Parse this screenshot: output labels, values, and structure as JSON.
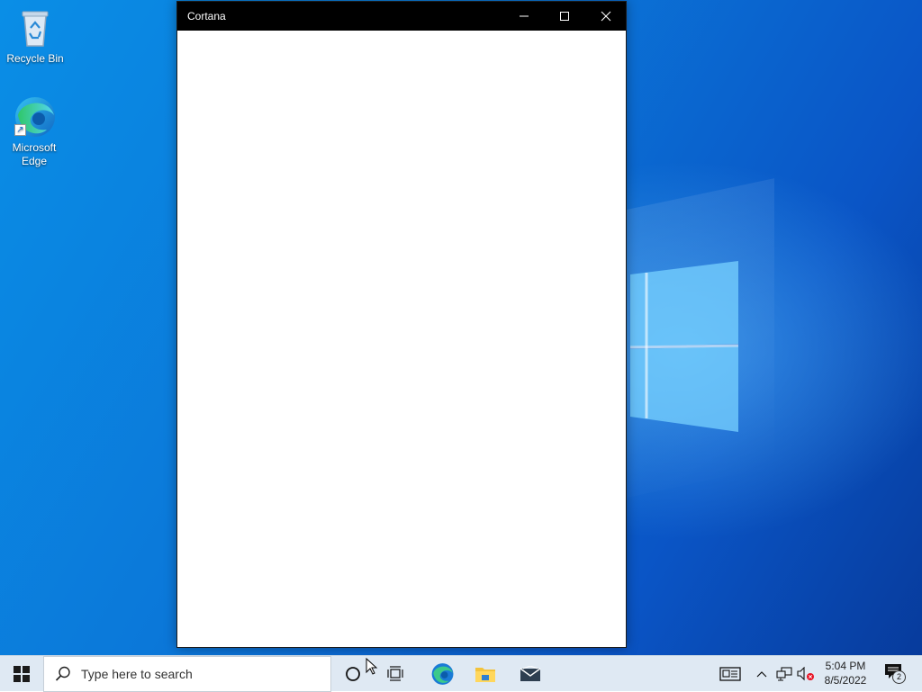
{
  "desktop": {
    "icons": [
      {
        "label": "Recycle Bin",
        "icon": "recycle-bin-icon"
      },
      {
        "label": "Microsoft\nEdge",
        "icon": "edge-icon"
      }
    ]
  },
  "window": {
    "title": "Cortana",
    "controls": [
      "minimize-icon",
      "maximize-icon",
      "close-icon"
    ]
  },
  "taskbar": {
    "search_placeholder": "Type here to search",
    "pinned": [
      "cortana-icon",
      "task-view-icon",
      "edge-icon",
      "file-explorer-icon",
      "mail-icon"
    ],
    "tray": [
      "news-icon",
      "chevron-up-icon",
      "network-icon",
      "volume-muted-icon"
    ],
    "clock": {
      "time": "5:04 PM",
      "date": "8/5/2022"
    },
    "notification_count": "2"
  },
  "colors": {
    "titlebar": "#000000",
    "taskbar": "#dfe9f3",
    "desktop_accent": "#0a78d7"
  }
}
